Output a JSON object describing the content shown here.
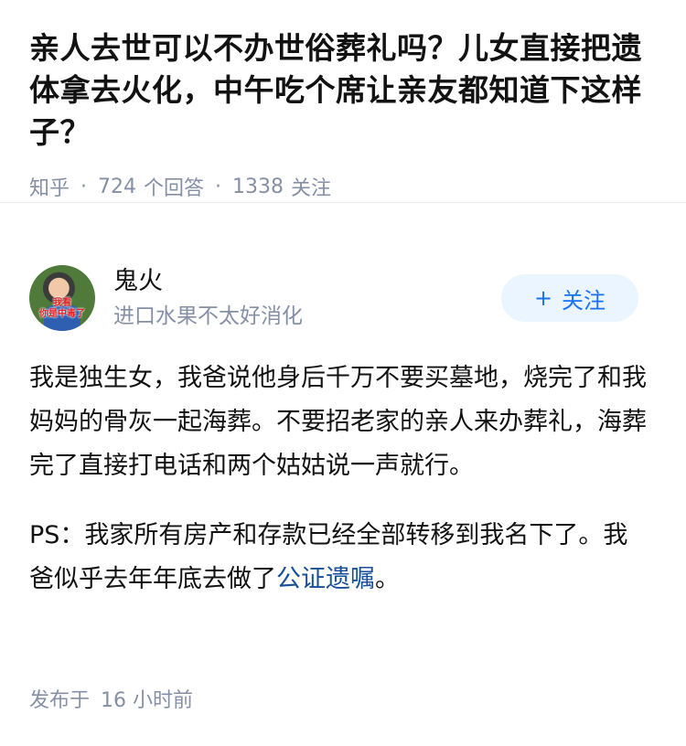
{
  "question": {
    "title": "亲人去世可以不办世俗葬礼吗？儿女直接把遗体拿去火化，中午吃个席让亲友都知道下这样子？",
    "source": "知乎",
    "separator": "·",
    "answers_count": "724",
    "answers_label": "个回答",
    "followers_count": "1338",
    "followers_label": "关注"
  },
  "author": {
    "name": "鬼火",
    "bio": "进口水果不太好消化",
    "avatar_text": [
      "我看",
      "你是中毒了"
    ],
    "follow_label": "关注",
    "follow_icon": "plus-icon"
  },
  "answer": {
    "paragraph_1": "我是独生女，我爸说他身后千万不要买墓地，烧完了和我妈妈的骨灰一起海葬。不要招老家的亲人来办葬礼，海葬完了直接打电话和两个姑姑说一声就行。",
    "paragraph_2_before_link": "PS：我家所有房产和存款已经全部转移到我名下了。我爸似乎去年年底去做了",
    "paragraph_2_link": "公证遗嘱",
    "paragraph_2_after_link": "。"
  },
  "footer": {
    "published_label": "发布于",
    "published_time": "16 小时前"
  },
  "colors": {
    "link": "#175199",
    "follow_button_bg": "#ebf5ff",
    "follow_button_text": "#1772f6",
    "meta_text": "#8590a6"
  }
}
